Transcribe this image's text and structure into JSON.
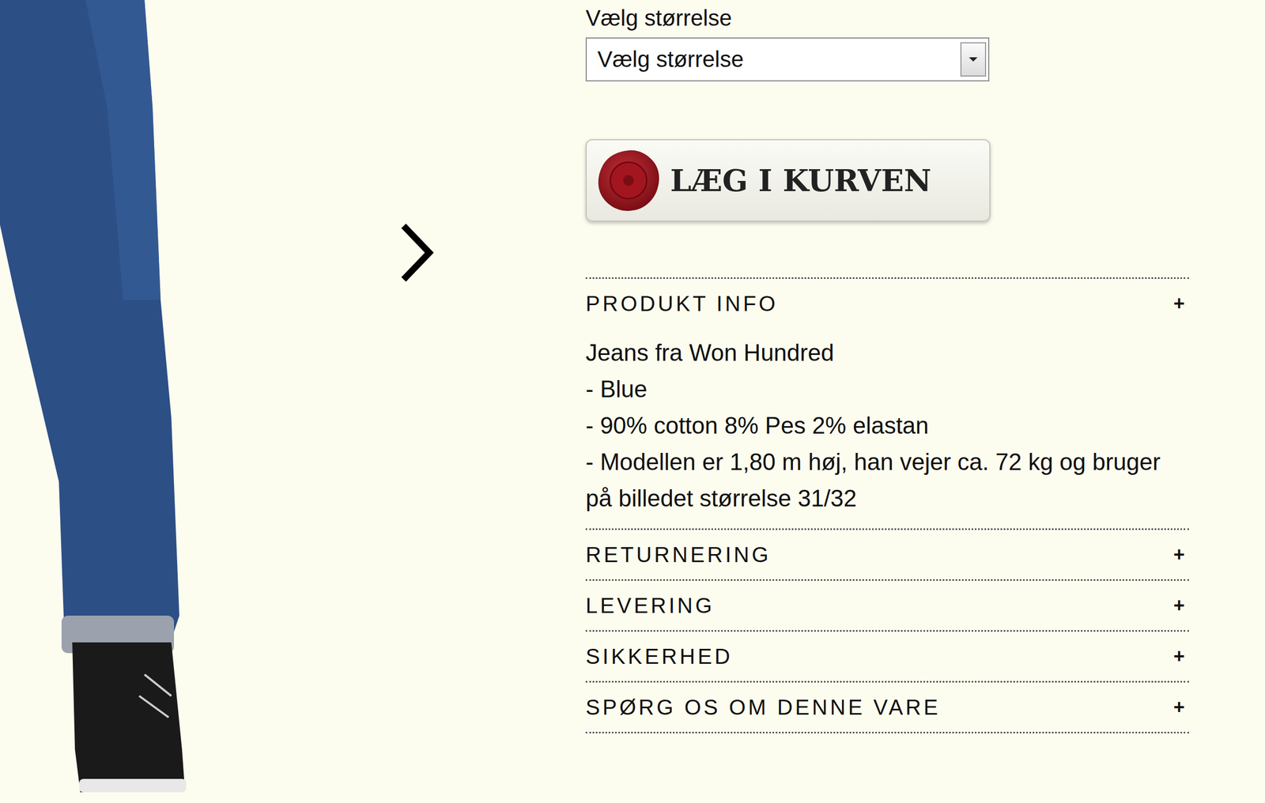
{
  "size_picker": {
    "label": "Vælg størrelse",
    "placeholder": "Vælg størrelse"
  },
  "add_to_cart": {
    "label": "LÆG I KURVEN"
  },
  "sections": [
    {
      "title": "PRODUKT INFO",
      "icon": "+",
      "expanded": true,
      "lines": [
        "Jeans fra Won Hundred",
        "- Blue",
        "- 90% cotton 8% Pes 2% elastan",
        "- Modellen er 1,80 m høj, han vejer ca. 72 kg og bruger på billedet størrelse 31/32"
      ]
    },
    {
      "title": "RETURNERING",
      "icon": "+",
      "expanded": false,
      "lines": []
    },
    {
      "title": "LEVERING",
      "icon": "+",
      "expanded": false,
      "lines": []
    },
    {
      "title": "SIKKERHED",
      "icon": "+",
      "expanded": false,
      "lines": []
    },
    {
      "title": "SPØRG OS OM DENNE VARE",
      "icon": "+",
      "expanded": false,
      "lines": []
    }
  ]
}
